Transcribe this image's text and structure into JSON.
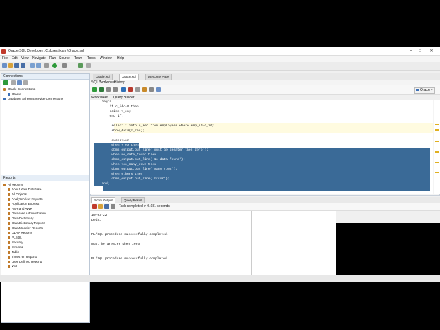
{
  "window": {
    "title": "Oracle SQL Developer : C:\\Users\\karin\\Oracle.sql"
  },
  "menu": [
    "File",
    "Edit",
    "View",
    "Navigate",
    "Run",
    "Source",
    "Team",
    "Tools",
    "Window",
    "Help"
  ],
  "connections": {
    "title": "Connections",
    "items": [
      "Oracle Connections",
      "Oracle",
      "Database Schema Service Connections"
    ]
  },
  "reports": {
    "title": "Reports",
    "items": [
      "All Reports",
      "About Your Database",
      "All Objects",
      "Analytic View Reports",
      "Application Express",
      "ASH and AWR",
      "Database Administration",
      "Data Dictionary",
      "Data Dictionary Reports",
      "Data Modeler Reports",
      "OLAP Reports",
      "PLSQL",
      "Security",
      "Streams",
      "Table",
      "TimesTen Reports",
      "User Defined Reports",
      "XML"
    ]
  },
  "editor": {
    "tabs": [
      "Oracle.sql",
      "Oracle.sql",
      "Welcome Page"
    ],
    "subtabs": [
      "SQL Worksheet",
      "History"
    ],
    "worksheet_tabs": [
      "Worksheet",
      "Query Builder"
    ],
    "connection": "Oracle",
    "code": [
      "    begin",
      "        if c_id<=0 then",
      "        raise v_ex;",
      "        end if;",
      "",
      "         select * into c_rec from employees where emp_id=c_id;",
      "         show_data(c_rec);",
      "",
      "         exception",
      "         when v_ex then",
      "         dbms_output.put_line('must be greater then zero');",
      "         when no_data_found then",
      "         dbms_output.put_line('No data found');",
      "         when too_many_rows then",
      "         dbms_output.put_line('Many rows');",
      "         when others then",
      "         dbms_output.put_line('Error');",
      "    end;"
    ]
  },
  "output": {
    "tabs": [
      "Script Output",
      "Query Result"
    ],
    "status": "Task completed in 0.031 seconds",
    "lines": [
      "10-03-22",
      "Delhi",
      "",
      "",
      "PL/SQL procedure successfully completed.",
      "",
      "must be greater then zero",
      "",
      "",
      "PL/SQL procedure successfully completed."
    ]
  }
}
